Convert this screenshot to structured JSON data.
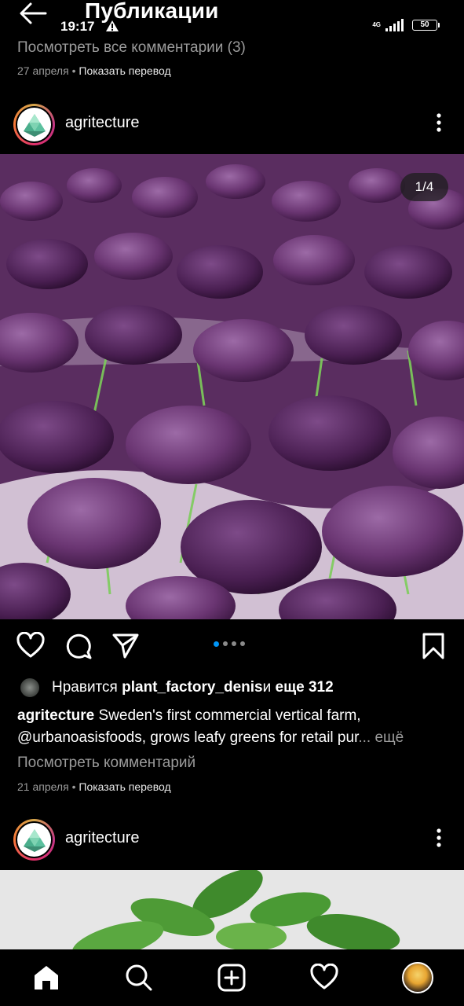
{
  "header": {
    "title": "Публикации",
    "back_icon": "arrow-left-icon"
  },
  "status_bar": {
    "time": "19:17",
    "network": "4G",
    "battery": "50"
  },
  "previous_post": {
    "view_all_comments": "Посмотреть все комментарии (3)",
    "date": "27 апреля",
    "separator": " • ",
    "translate": "Показать перевод"
  },
  "post": {
    "username": "agritecture",
    "image_counter": "1/4",
    "carousel": {
      "count": 4,
      "active_index": 0
    },
    "likes": {
      "prefix": "Нравится ",
      "user": "plant_factory_denis",
      "middle": " и ",
      "count": "еще 312"
    },
    "caption": {
      "username": "agritecture",
      "text": " Sweden's first commercial vertical farm, @urbanoasisfoods, grows leafy greens for retail pur",
      "ellipsis": "... ",
      "more": "ещё"
    },
    "view_comments": "Посмотреть комментарий",
    "date": "21 апреля",
    "separator": " • ",
    "translate": "Показать перевод"
  },
  "next_post": {
    "username": "agritecture"
  },
  "bottom_nav": {
    "items": [
      "home-icon",
      "search-icon",
      "create-icon",
      "activity-icon",
      "profile-avatar"
    ]
  },
  "colors": {
    "background": "#000000",
    "muted_text": "#9b9b9b",
    "accent_blue": "#0095f6"
  }
}
